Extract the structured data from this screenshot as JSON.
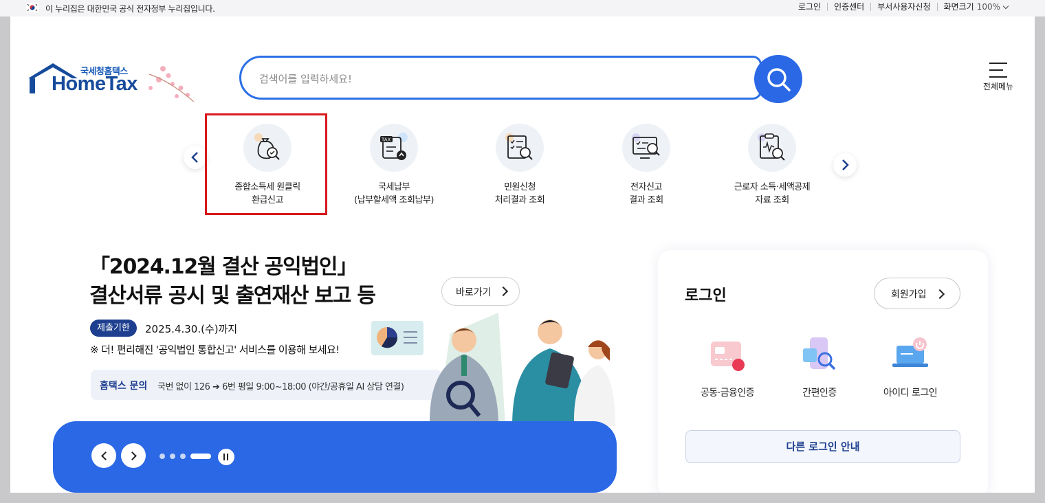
{
  "gov_banner": {
    "text": "이 누리집은 대한민국 공식 전자정부 누리집입니다.",
    "links": [
      "로그인",
      "인증센터",
      "부서사용자신청",
      "화면크기"
    ],
    "zoom": "100%"
  },
  "logo": {
    "small": "국세청홈택스",
    "main": "HomeTax"
  },
  "search": {
    "placeholder": "검색어를 입력하세요!"
  },
  "all_menu_label": "전체메뉴",
  "quick_menu": [
    {
      "label": "종합소득세 원클릭\n환급신고",
      "icon": "money-bag-magnifier-icon"
    },
    {
      "label": "국세납부\n(납부할세액 조회납부)",
      "icon": "tax-document-upload-icon"
    },
    {
      "label": "민원신청\n처리결과 조회",
      "icon": "document-checklist-search-icon"
    },
    {
      "label": "전자신고\n결과 조회",
      "icon": "monitor-search-icon"
    },
    {
      "label": "근로자 소득·세액공제\n자료 조회",
      "icon": "clipboard-search-icon"
    }
  ],
  "banner": {
    "title": "「2024.12월 결산 공익법인」\n결산서류 공시 및 출연재산 보고 등",
    "go_label": "바로가기",
    "deadline_badge": "제출기한",
    "deadline_date": "2025.4.30.(수)까지",
    "notice": "※ 더! 편리해진 '공익법인 통합신고' 서비스를 이용해 보세요!",
    "inquiry_label": "홈택스 문의",
    "inquiry_text": "국번 없이 126 ➔ 6번 평일 9:00~18:00 (야간/공휴일 AI 상담 연결)",
    "slide_count": 4,
    "active_slide": 4
  },
  "login": {
    "title": "로그인",
    "signup_label": "회원가입",
    "methods": [
      {
        "label": "공동·금융인증",
        "icon": "certificate-card-icon"
      },
      {
        "label": "간편인증",
        "icon": "phone-search-icon"
      },
      {
        "label": "아이디 로그인",
        "icon": "laptop-power-icon"
      }
    ],
    "other_login_label": "다른 로그인 안내"
  },
  "colors": {
    "primary": "#2a68e6",
    "navy": "#1e3f8f",
    "highlight": "#d7191c"
  }
}
